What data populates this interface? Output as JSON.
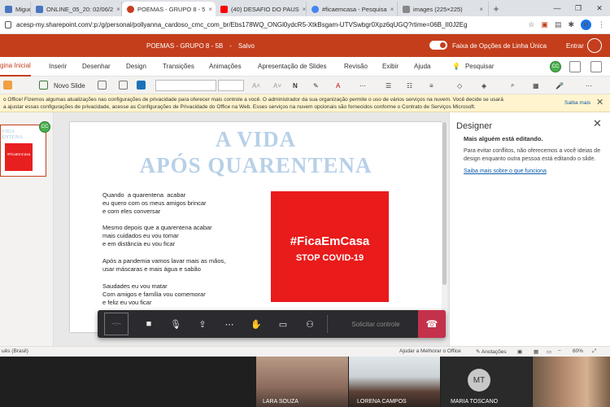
{
  "browser": {
    "tabs": [
      {
        "label": "Miguel ×",
        "color": "#4a76c0"
      },
      {
        "label": "ONLINE_05_20: 02/06/2",
        "color": "#4a76c0"
      },
      {
        "label": "POEMAS - GRUPO 8 - 5",
        "color": "#c43e1c"
      },
      {
        "label": "(40) DESAFIO DO PAUS",
        "color": "#ff0000"
      },
      {
        "label": "#ficaemcasa - Pesquisa",
        "color": "#4285f4"
      },
      {
        "label": "images (225×225)",
        "color": "#888888"
      }
    ],
    "new_tab": "+",
    "url": "acesp-my.sharepoint.com/:p:/g/personal/pollyanna_cardoso_cmc_com_br/Ebs178WQ_ONGl0ydcR5-XtkBsgam-UTVSwbgr0Xpz6qUGQ?rtime=06B_II0J2Eg",
    "profile_initial": "R"
  },
  "office": {
    "doc_title": "POEMAS - GRUPO 8 - 5B",
    "saved": "Salvo",
    "single_line_label": "Faixa de Opções de Linha Única",
    "signin": "Entrar",
    "ribbon_tabs": [
      "gina Inicial",
      "Inserir",
      "Desenhar",
      "Design",
      "Transições",
      "Animações",
      "Apresentação de Slides",
      "Revisão",
      "Exibir",
      "Ajuda"
    ],
    "search": "Pesquisar",
    "cc": "CC",
    "new_slide": "Novo Slide"
  },
  "privacy": {
    "line1": "o Office! Fizemos algumas atualizações nas configurações de privacidade para oferecer mais controle a você. O administrador da sua organização permite o uso de vários serviços na nuvem. Você decide se usará",
    "line2": "a ajustar essas configurações de privacidade, acesse as Configurações de Privacidade do Office na Web. Esses serviços na nuvem opcionais são fornecidos conforme o Contrato de Serviços Microsoft.",
    "more": "Saiba mais"
  },
  "thumbnail": {
    "title_1": "VIDA",
    "title_2": "ENTENA",
    "badge": "#FicaEmCasa"
  },
  "slide": {
    "title_1": "A VIDA",
    "title_2": "APÓS  QUARENTENA",
    "stanzas": [
      "Quando  a quarentena  acabar\neu quero com os meus amigos brincar\ne com eles conversar",
      "Mesmo depois que a quarentena acabar\nmais cuidados eu vou tomar\ne em distância eu vou ficar",
      "Após a pandemia vamos lavar mais as mãos,\nusar máscaras e mais água e sabão",
      "Saudades eu vou matar\nCom amigos e família vou comemorar\ne feliz eu vou ficar"
    ],
    "hashtag": "#FicaEmCasa",
    "stop": "STOP COVID-19",
    "accent_red": "#e91b1b",
    "title_color": "#b8d0e8"
  },
  "designer": {
    "title": "Designer",
    "subtitle": "Mais alguém está editando.",
    "body": "Para evitar conflitos, não oferecemos a você ideias de design enquanto outra pessoa está editando o slide.",
    "link": "Saiba mais sobre o que funciona"
  },
  "call": {
    "timer": "--:--",
    "request_control": "Solicitar controle"
  },
  "status": {
    "language": "uês (Brasil)",
    "help": "Ajudar a Melhorar o Office",
    "notes": "Anotações",
    "zoom": "60%"
  },
  "participants": [
    {
      "name": "LARA SOUZA"
    },
    {
      "name": "LORENA CAMPOS"
    },
    {
      "name": "MARIA TOSCANO",
      "initials": "MT"
    },
    {
      "name": ""
    }
  ]
}
